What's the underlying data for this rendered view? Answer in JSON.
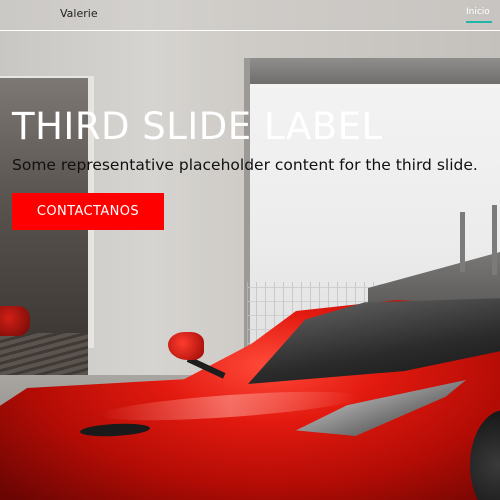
{
  "navbar": {
    "brand": "Valerie",
    "links": [
      {
        "label": "Inicio",
        "active": true
      }
    ]
  },
  "carousel": {
    "slide": {
      "title": "THIRD SLIDE LABEL",
      "text": "Some representative placeholder content for the third slide.",
      "cta_label": "CONTACTANOS"
    }
  },
  "colors": {
    "cta_background": "#ff0000",
    "nav_active_underline": "#1fb5a8",
    "title": "#ffffff",
    "caption_text": "#111111"
  },
  "background_image": "red-sports-car-in-showroom"
}
